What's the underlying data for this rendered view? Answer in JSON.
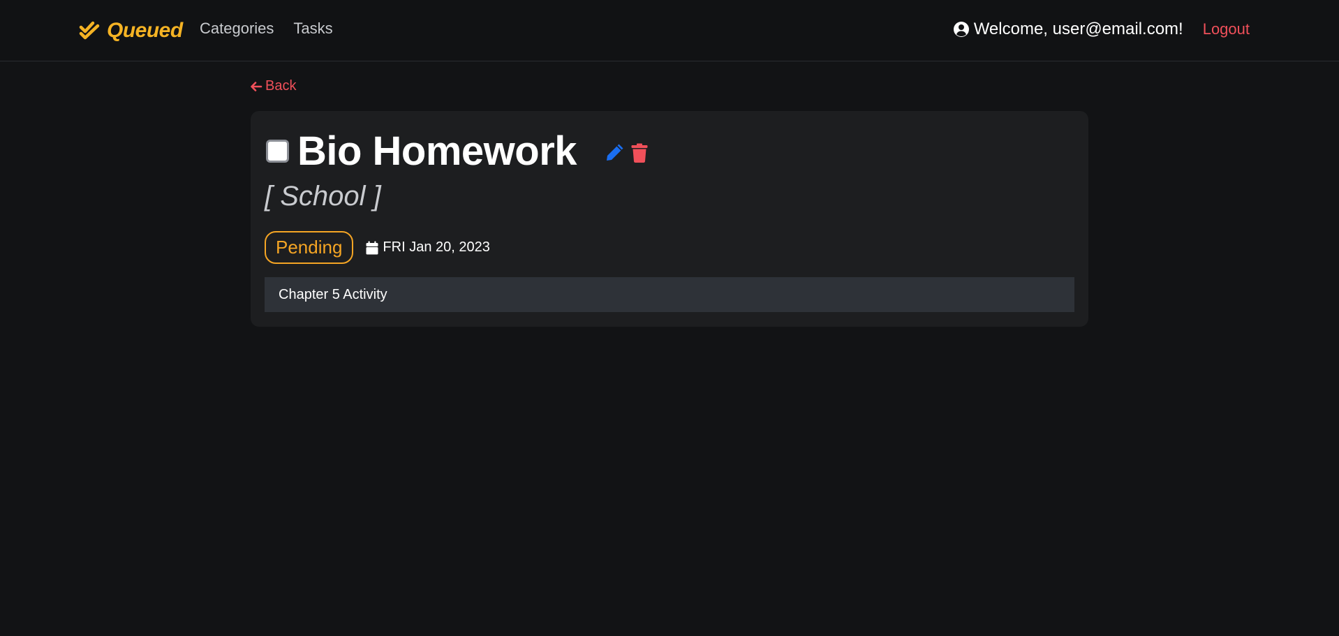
{
  "brand": {
    "name": "Queued",
    "icon": "double-check-icon",
    "color": "#f5b324"
  },
  "nav": {
    "links": [
      "Categories",
      "Tasks"
    ]
  },
  "user": {
    "welcome": "Welcome, user@email.com!",
    "icon": "user-circle-icon"
  },
  "logout_label": "Logout",
  "back_label": "Back",
  "task": {
    "title": "Bio Homework",
    "category": "[ School ]",
    "status": "Pending",
    "due_date": "FRI Jan 20, 2023",
    "description": "Chapter 5 Activity",
    "completed": false,
    "edit_icon": "pencil-icon",
    "delete_icon": "trash-icon"
  },
  "colors": {
    "accent": "#f5b324",
    "danger": "#f0505a",
    "edit": "#1a6ef0",
    "status_pending": "#f5a524",
    "background": "#121315",
    "card": "#1d1e20"
  }
}
